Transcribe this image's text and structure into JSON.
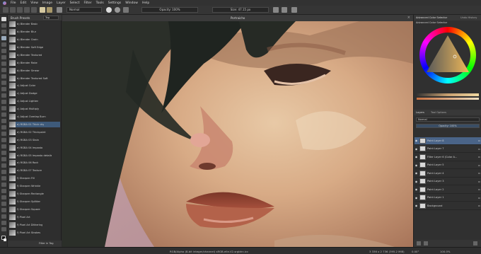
{
  "menu": [
    "File",
    "Edit",
    "View",
    "Image",
    "Layer",
    "Select",
    "Filter",
    "Tools",
    "Settings",
    "Window",
    "Help"
  ],
  "toolbar": {
    "blend_mode": "Normal",
    "opacity_label": "Opacity: 100%",
    "size_label": "Size: 47.15 px"
  },
  "presets": {
    "title": "Brush Presets",
    "tag_label": "Tag",
    "items": [
      "b) Blender Basic",
      "b) Blender Blur",
      "b) Blender Grain",
      "b) Blender Soft Edge",
      "b) Blender Textured",
      "b) Blender Rake",
      "b) Blender Smear",
      "b) Blender Textured Soft",
      "c) Adjust Color",
      "c) Adjust Dodge",
      "c) Adjust Lighten",
      "c) Adjust Multiply",
      "c) Adjust Overlap Burn",
      "e) RGBA 01 Thick dry",
      "e) RGBA 02 Thickpaint",
      "e) RGBA 03 Stain",
      "e) RGBA 04 Impasto",
      "e) RGBA 05 Impasto details",
      "e) RGBA 06 Rock",
      "e) RGBA 07 Texture",
      "f) Sharpen Fill",
      "f) Sharpen Wrinkle",
      "f) Sharpen Rectangle",
      "f) Sharpen Splitter",
      "f) Sharpen Square",
      "f) Pixel Art",
      "f) Pixel Art Dithering",
      "f) Pixel Art Strokes"
    ],
    "active_index": 13,
    "filter_label": "Filter in Tag"
  },
  "canvas": {
    "tab_title": "Portraicho"
  },
  "color_selector": {
    "tabs": [
      "Advanced Color Selector",
      "Undo History"
    ],
    "header": "Advanced Color Selector"
  },
  "layers_docker": {
    "tabs": [
      "Layers",
      "Tool Options"
    ],
    "blend_mode": "Normal",
    "opacity_label": "Opacity: 100%",
    "items": [
      {
        "name": "Paint Layer 8"
      },
      {
        "name": "Paint Layer 7"
      },
      {
        "name": "Filter Layer 6 (Color A..."
      },
      {
        "name": "Paint Layer 5"
      },
      {
        "name": "Paint Layer 4"
      },
      {
        "name": "Paint Layer 3"
      },
      {
        "name": "Paint Layer 2"
      },
      {
        "name": "Paint Layer 1"
      },
      {
        "name": "Background"
      }
    ],
    "active_index": 0
  },
  "status": {
    "left": "RGB/Alpha (8-bit integer/channel) sRGB-elle-V2-srgbtrc.icc",
    "size": "3 336 x 2 736 (395.2 MiB)",
    "rotation": "0.00°",
    "zoom": "100.0%"
  },
  "colors": {
    "accent": "#4a6488",
    "bg": "#2b2b2b"
  }
}
